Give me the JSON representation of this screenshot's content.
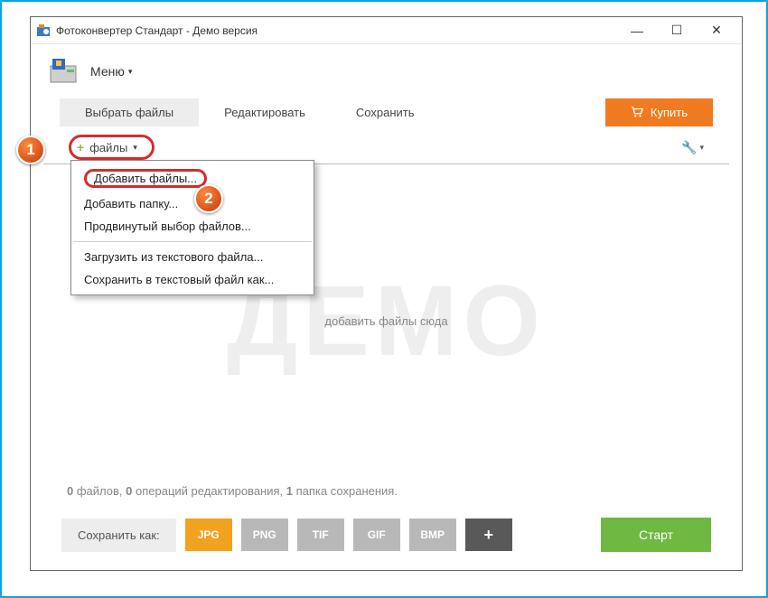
{
  "window": {
    "title": "Фотоконвертер Стандарт - Демо версия",
    "min": "—",
    "max": "☐",
    "close": "✕"
  },
  "menu": {
    "label": "Меню"
  },
  "tabs": {
    "select": "Выбрать файлы",
    "edit": "Редактировать",
    "save": "Сохранить"
  },
  "buy": {
    "label": "Купить"
  },
  "files_button": {
    "label": "файлы"
  },
  "dropdown": {
    "add_files": "Добавить файлы...",
    "add_folder": "Добавить папку...",
    "advanced": "Продвинутый выбор файлов...",
    "load_txt": "Загрузить из текстового файла...",
    "save_txt": "Сохранить в текстовый файл как..."
  },
  "stage": {
    "watermark": "ДЕМО",
    "drop_hint": "добавить файлы сюда"
  },
  "status": {
    "files_count": "0",
    "files_word": "файлов,",
    "ops_count": "0",
    "ops_word": "операций редактирования,",
    "save_count": "1",
    "save_word": "папка сохранения."
  },
  "bottom": {
    "save_as": "Сохранить как:",
    "jpg": "JPG",
    "png": "PNG",
    "tif": "TIF",
    "gif": "GIF",
    "bmp": "BMP",
    "plus": "+",
    "start": "Старт"
  },
  "callouts": {
    "one": "1",
    "two": "2"
  }
}
